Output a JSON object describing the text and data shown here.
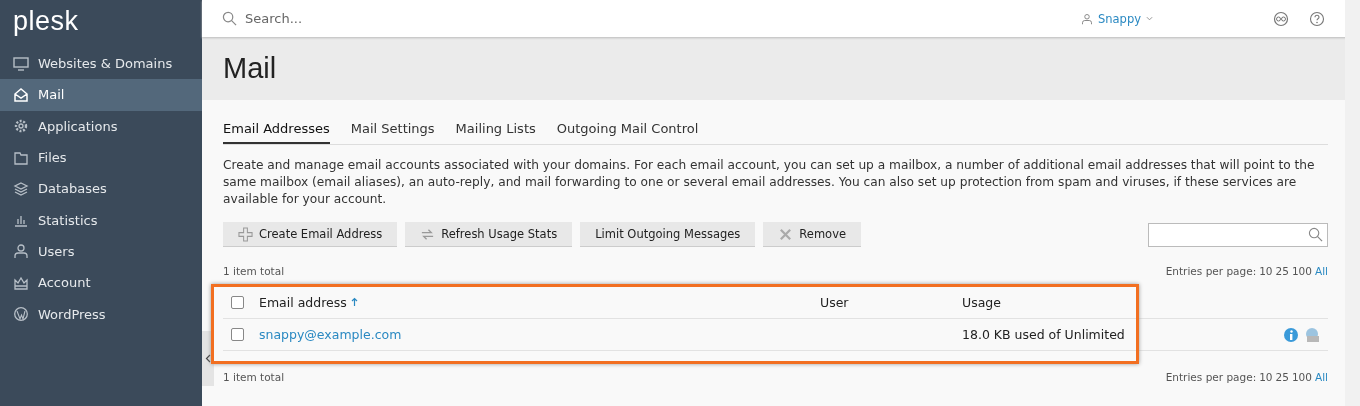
{
  "sidebar": {
    "logo": "plesk",
    "items": [
      {
        "label": "Websites & Domains",
        "selected": false
      },
      {
        "label": "Mail",
        "selected": true
      },
      {
        "label": "Applications",
        "selected": false
      },
      {
        "label": "Files",
        "selected": false
      },
      {
        "label": "Databases",
        "selected": false
      },
      {
        "label": "Statistics",
        "selected": false
      },
      {
        "label": "Users",
        "selected": false
      },
      {
        "label": "Account",
        "selected": false
      },
      {
        "label": "WordPress",
        "selected": false
      }
    ]
  },
  "topbar": {
    "search": {
      "placeholder": "Search..."
    },
    "user": "Snappy"
  },
  "page": {
    "title": "Mail",
    "tabs": [
      {
        "label": "Email Addresses",
        "selected": true
      },
      {
        "label": "Mail Settings",
        "selected": false
      },
      {
        "label": "Mailing Lists",
        "selected": false
      },
      {
        "label": "Outgoing Mail Control",
        "selected": false
      }
    ],
    "description": "Create and manage email accounts associated with your domains. For each email account, you can set up a mailbox, a number of additional email addresses that will point to the same mailbox (email aliases), an auto-reply, and mail forwarding to one or several email addresses. You can also set up protection from spam and viruses, if these services are available for your account.",
    "toolbar": [
      {
        "label": "Create Email Address"
      },
      {
        "label": "Refresh Usage Stats"
      },
      {
        "label": "Limit Outgoing Messages"
      },
      {
        "label": "Remove"
      }
    ],
    "total_top": "1 item total",
    "total_bottom": "1 item total",
    "entries_top": {
      "label": "Entries per page:",
      "options": [
        {
          "label": "10",
          "link": false
        },
        {
          "label": "25",
          "link": false
        },
        {
          "label": "100",
          "link": false
        },
        {
          "label": "All",
          "link": true
        }
      ]
    },
    "entries_bottom": {
      "label": "Entries per page:",
      "options": [
        {
          "label": "10",
          "link": false
        },
        {
          "label": "25",
          "link": false
        },
        {
          "label": "100",
          "link": false
        },
        {
          "label": "All",
          "link": true
        }
      ]
    },
    "table": {
      "highlighted": true,
      "columns": [
        {
          "label": "Email address",
          "sorted": true
        },
        {
          "label": "User",
          "sorted": false
        },
        {
          "label": "Usage",
          "sorted": false
        }
      ],
      "header_checked": false,
      "rows": [
        {
          "checked": false,
          "email": "snappy@example.com",
          "usage": "18.0 KB used of Unlimited"
        }
      ]
    }
  }
}
